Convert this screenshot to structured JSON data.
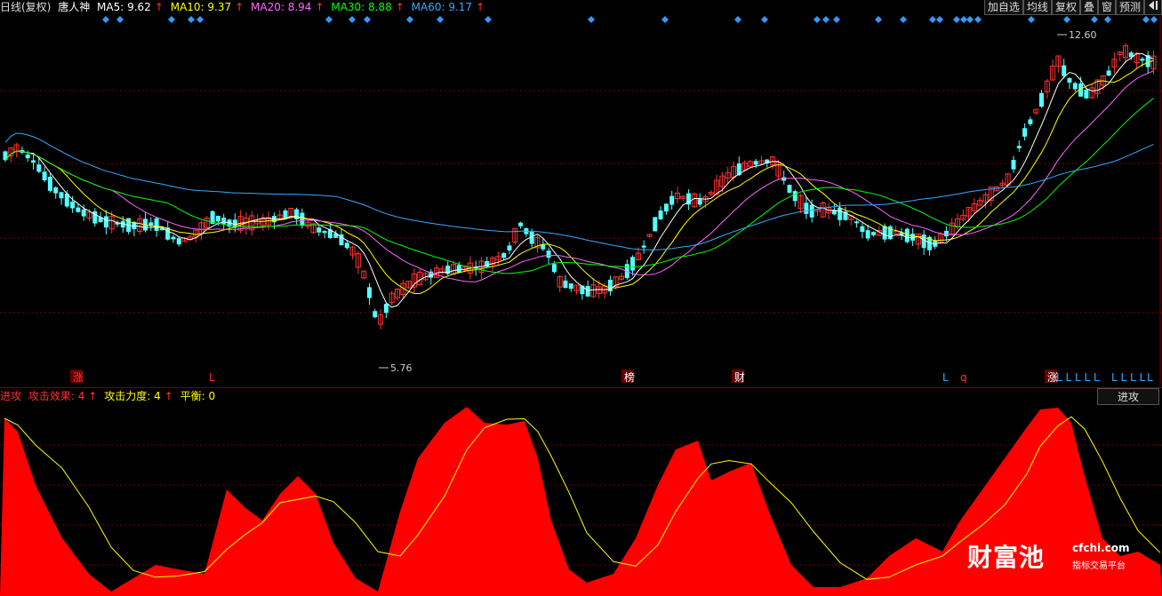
{
  "header": {
    "period": "日线(复权)",
    "stock_name": "唐人神",
    "ma": [
      {
        "label": "MA5: 9.62",
        "color": "#ffffff"
      },
      {
        "label": "MA10: 9.37",
        "color": "#ffff00"
      },
      {
        "label": "MA20: 8.94",
        "color": "#ff66ff"
      },
      {
        "label": "MA30: 8.88",
        "color": "#00ff00"
      },
      {
        "label": "MA60: 9.17",
        "color": "#33aaff"
      }
    ],
    "up_arrow": "↑"
  },
  "toolbar": {
    "add_favorite": "加自选",
    "ma_line": "均线",
    "restore_rights": "复权",
    "overlay": "叠",
    "window": "窗",
    "forecast": "预测",
    "exit_icon": "exit-icon"
  },
  "price_chart": {
    "high_label": "12.60",
    "low_label": "5.76",
    "bottom_signals": [
      "涨",
      "L",
      "榜",
      "财",
      "L",
      "q",
      "涨",
      "L L L L L",
      "L L L L",
      "L"
    ]
  },
  "indicator": {
    "name": "进攻",
    "effect_label": "攻击效果: 4",
    "force_label": "攻击力度: 4",
    "balance_label": "平衡: 0",
    "tab_label": "进攻"
  },
  "watermark": {
    "brand": "财富池",
    "url": "cfchi.com",
    "subtitle": "指标交易平台"
  },
  "colors": {
    "up": "#ff3232",
    "down": "#54ffff",
    "grid": "#7a0000",
    "ma5": "#ffffff",
    "ma10": "#ffff00",
    "ma20": "#ff66ff",
    "ma30": "#00ff00",
    "ma60": "#33aaff",
    "area": "#ff0000"
  }
}
